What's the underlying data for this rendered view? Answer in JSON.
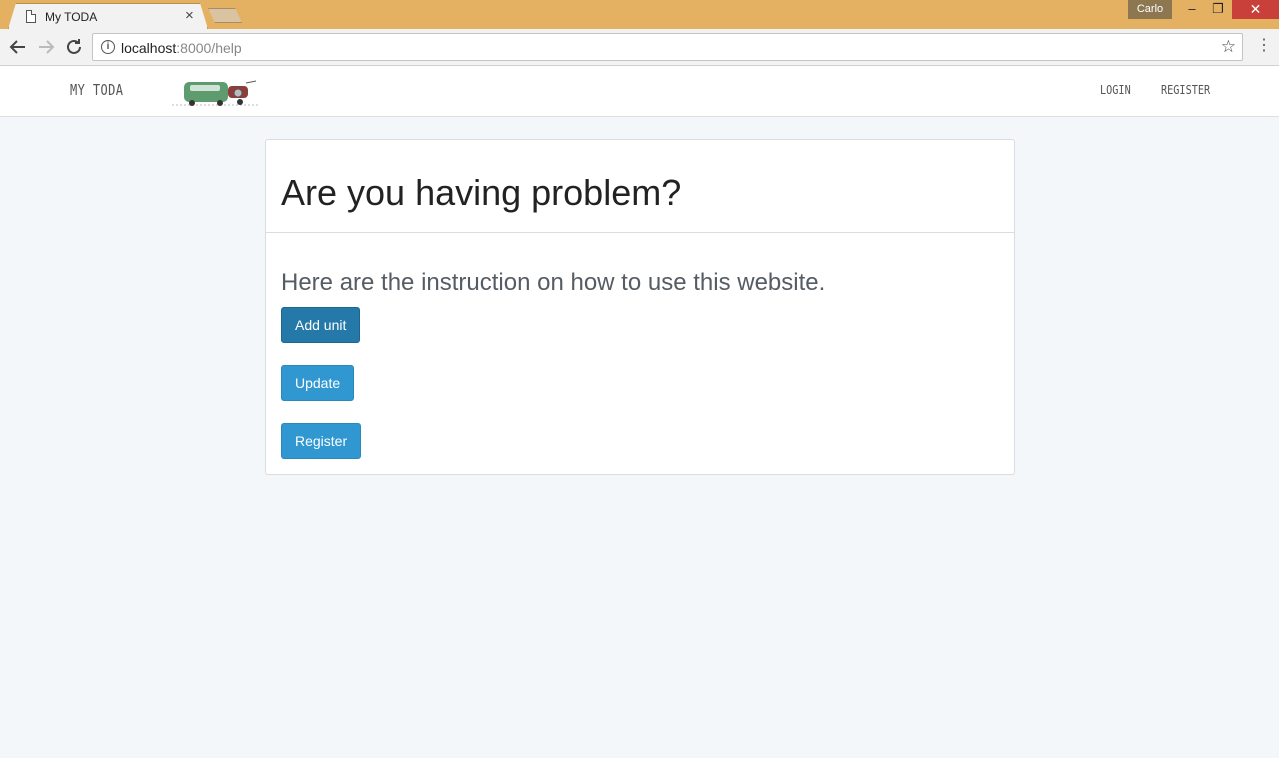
{
  "browser": {
    "tab_title": "My TODA",
    "tab_close": "×",
    "profile_name": "Carlo",
    "url_host": "localhost",
    "url_path": ":8000/help",
    "win_min": "–",
    "win_max": "❐",
    "win_close": "✕"
  },
  "navbar": {
    "brand": "MY TODA",
    "login": "LOGIN",
    "register": "REGISTER"
  },
  "panel": {
    "title": "Are you having problem?",
    "subtitle": "Here are the instruction on how to use this website.",
    "buttons": [
      "Add unit",
      "Update",
      "Register"
    ]
  },
  "colors": {
    "titlebar": "#e4b163",
    "button_primary": "#3097d1",
    "button_active": "#2579a9",
    "page_background": "#f4f7fa"
  }
}
